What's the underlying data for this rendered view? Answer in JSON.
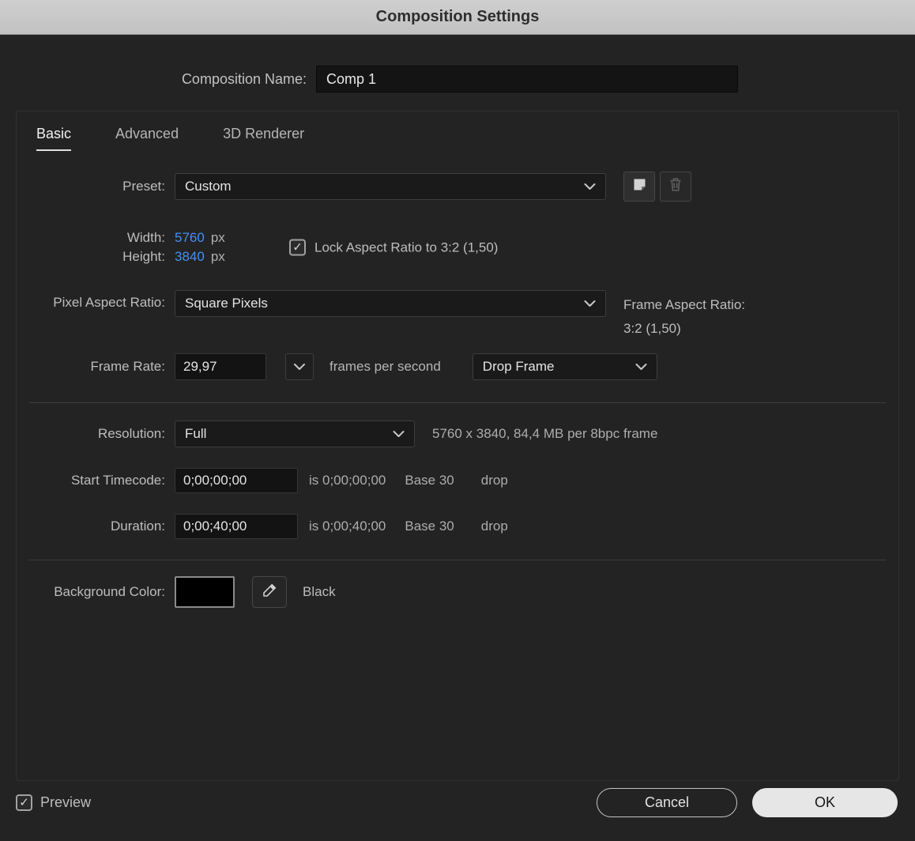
{
  "title": "Composition Settings",
  "glyphs": {
    "check": "✓"
  },
  "colors": {
    "accent_blue": "#4390f7",
    "dialog_background": "#232323",
    "titlebar_background": "#c7c7c7",
    "swatch_color": "#000000"
  },
  "composition_name": {
    "label": "Composition Name:",
    "value": "Comp 1"
  },
  "tabs": [
    {
      "label": "Basic",
      "active": true
    },
    {
      "label": "Advanced",
      "active": false
    },
    {
      "label": "3D Renderer",
      "active": false
    }
  ],
  "preset": {
    "label": "Preset:",
    "value": "Custom"
  },
  "width": {
    "label": "Width:",
    "value": "5760",
    "unit": "px"
  },
  "height": {
    "label": "Height:",
    "value": "3840",
    "unit": "px"
  },
  "lock_aspect": {
    "label": "Lock Aspect Ratio to 3:2 (1,50)",
    "checked": true
  },
  "pixel_aspect_ratio": {
    "label": "Pixel Aspect Ratio:",
    "value": "Square Pixels"
  },
  "frame_aspect_ratio": {
    "label": "Frame Aspect Ratio:",
    "value": "3:2 (1,50)"
  },
  "frame_rate": {
    "label": "Frame Rate:",
    "value": "29,97",
    "suffix": "frames per second",
    "dropframe_value": "Drop Frame"
  },
  "resolution": {
    "label": "Resolution:",
    "value": "Full",
    "info": "5760 x 3840, 84,4 MB per 8bpc frame"
  },
  "start_timecode": {
    "label": "Start Timecode:",
    "value": "0;00;00;00",
    "info_is": "is 0;00;00;00",
    "base": "Base 30",
    "drop": "drop"
  },
  "duration": {
    "label": "Duration:",
    "value": "0;00;40;00",
    "info_is": "is 0;00;40;00",
    "base": "Base 30",
    "drop": "drop"
  },
  "background_color": {
    "label": "Background Color:",
    "color_name": "Black"
  },
  "footer": {
    "preview_label": "Preview",
    "preview_checked": true,
    "cancel_label": "Cancel",
    "ok_label": "OK"
  }
}
